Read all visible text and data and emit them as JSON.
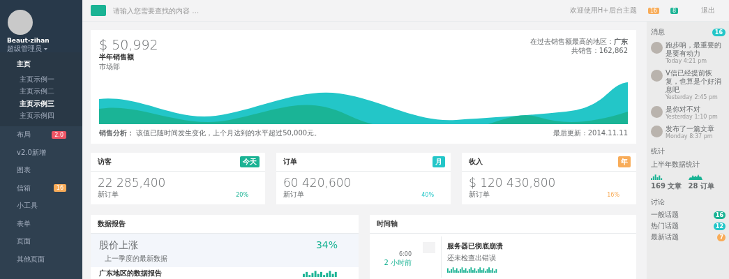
{
  "profile": {
    "name": "Beaut-zihan",
    "role": "超级管理员"
  },
  "nav": [
    {
      "label": "主页",
      "expanded": true,
      "children": [
        {
          "label": "主页示例一",
          "selected": false
        },
        {
          "label": "主页示例二",
          "selected": false
        },
        {
          "label": "主页示例三",
          "selected": true
        },
        {
          "label": "主页示例四",
          "selected": false
        }
      ]
    },
    {
      "label": "布局",
      "expanded": false,
      "badge": "2.0",
      "color": "#ed5565"
    },
    {
      "label": "v2.0新增",
      "expanded": false
    },
    {
      "label": "图表",
      "expanded": false
    },
    {
      "label": "信箱",
      "expanded": false,
      "badge": "16",
      "color": "#f8ac59"
    },
    {
      "label": "小工具",
      "expanded": false
    },
    {
      "label": "表单",
      "expanded": false
    },
    {
      "label": "页面",
      "expanded": false
    },
    {
      "label": "其他页面",
      "expanded": false
    }
  ],
  "topbar": {
    "search_placeholder": "请输入您需要查找的内容 …",
    "welcome": "欢迎使用H+后台主题",
    "badges": [
      {
        "text": "16",
        "color": "#f8ac59"
      },
      {
        "text": "8",
        "color": "#1ab394"
      }
    ],
    "logout": "退出"
  },
  "sales": {
    "amount": "$ 50,992",
    "title": "半年销售额",
    "dept": "市场部",
    "region": "在过去销售额最高的地区：**广东**",
    "total": "共销售：162,862",
    "analysis": "**销售分析：** 该值已随时间发生变化，上个月达到的水平超过50,000元。",
    "updated": "最后更新：2014.11.11"
  },
  "stats": [
    {
      "title": "访客",
      "badge": "今天",
      "color": "#1ab394",
      "value": "22 285,400",
      "sub": "新订单",
      "percent": "20%"
    },
    {
      "title": "订单",
      "badge": "月",
      "color": "#23c6c8",
      "value": "60 420,600",
      "sub": "新订单",
      "percent": "40%"
    },
    {
      "title": "收入",
      "badge": "年",
      "color": "#f8ac59",
      "value": "$ 120 430,800",
      "sub": "新订单",
      "percent": "16%"
    }
  ],
  "report": {
    "title": "数据报告",
    "highlight": {
      "title": "股价上涨",
      "value": "34%",
      "sub": "上一季度的最新数据"
    },
    "row": "广东地区的数据报告"
  },
  "timeline": {
    "title": "时间轴",
    "entries": [
      {
        "time": "6:00",
        "ago": "2 小时前",
        "title": "服务器已彻底崩溃",
        "text": "还未检查出错误"
      }
    ]
  },
  "messages": {
    "title": "消息",
    "count": "16",
    "items": [
      {
        "text": "跑步呐，最重要的是要有动力",
        "time": "Today 4:21 pm"
      },
      {
        "text": "V信已经提前恢复，也算是个好消息吧",
        "time": "Yesterday 2:45 pm"
      },
      {
        "text": "是你对不对",
        "time": "Yesterday 1:10 pm"
      },
      {
        "text": "发布了一篇文章",
        "time": "Monday 8:37 pm"
      }
    ]
  },
  "statistics": {
    "title": "统计",
    "subtitle": "上半年数据统计",
    "items": [
      {
        "label": "169 文章"
      },
      {
        "label": "28 订单"
      }
    ]
  },
  "discussion": {
    "title": "讨论",
    "items": [
      {
        "label": "一般话题",
        "count": "16",
        "color": "#1ab394"
      },
      {
        "label": "热门话题",
        "count": "12",
        "color": "#23c6c8"
      },
      {
        "label": "最新话题",
        "count": "7",
        "color": "#f8ac59"
      }
    ]
  }
}
